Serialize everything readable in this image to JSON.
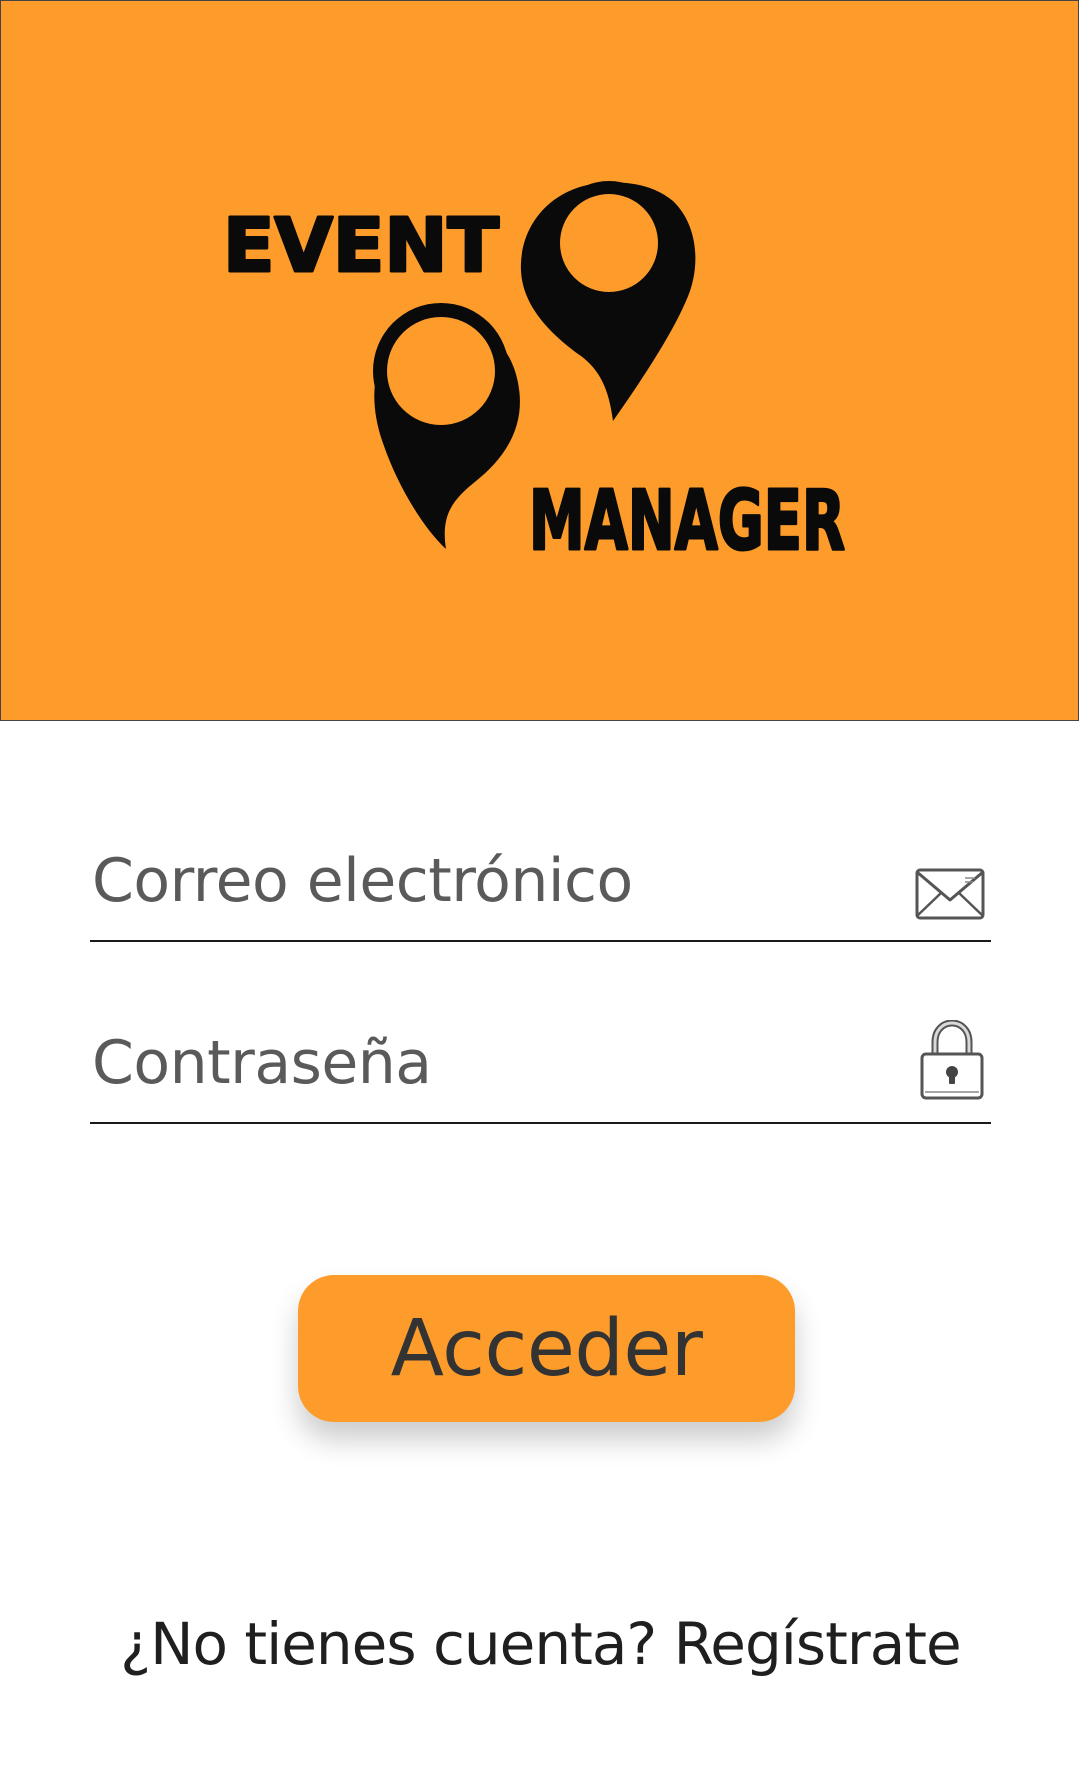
{
  "brand": {
    "logo_line1": "EVENT",
    "logo_line2": "MANAGER",
    "header_color": "#fd9c2b",
    "accent_color": "#fd9c2b"
  },
  "form": {
    "email": {
      "placeholder": "Correo electrónico",
      "icon": "envelope-icon"
    },
    "password": {
      "placeholder": "Contraseña",
      "icon": "padlock-icon"
    },
    "submit_label": "Acceder"
  },
  "footer": {
    "question": "¿No tienes cuenta?",
    "register_label": "Regístrate"
  }
}
